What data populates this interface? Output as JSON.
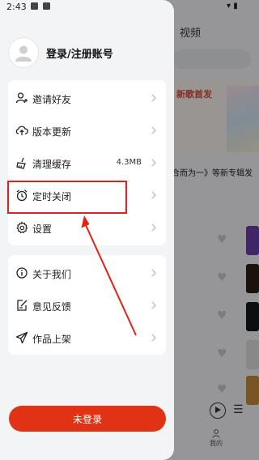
{
  "status_bar": {
    "time": "2:43",
    "icons": [
      "image-icon",
      "notification-icon"
    ]
  },
  "profile": {
    "login_text": "登录/注册账号"
  },
  "menu_group1": [
    {
      "label": "邀请好友",
      "icon": "user-add-icon"
    },
    {
      "label": "版本更新",
      "icon": "cloud-upload-icon"
    },
    {
      "label": "清理缓存",
      "icon": "broom-icon",
      "value": "4.3MB"
    },
    {
      "label": "定时关闭",
      "icon": "alarm-clock-icon"
    },
    {
      "label": "设置",
      "icon": "gear-icon"
    }
  ],
  "menu_group2": [
    {
      "label": "关于我们",
      "icon": "info-icon"
    },
    {
      "label": "意见反馈",
      "icon": "feedback-edit-icon"
    },
    {
      "label": "作品上架",
      "icon": "send-icon"
    }
  ],
  "logout_button": "未登录",
  "background": {
    "tab_label": "视频",
    "banner_text": "新歌首发",
    "banner_caption": "合而为一》等新专辑发",
    "bottom_nav_mine": "我的"
  },
  "colors": {
    "accent": "#e23216",
    "highlight": "#e32119",
    "drawer_bg": "#f3f4f6"
  }
}
